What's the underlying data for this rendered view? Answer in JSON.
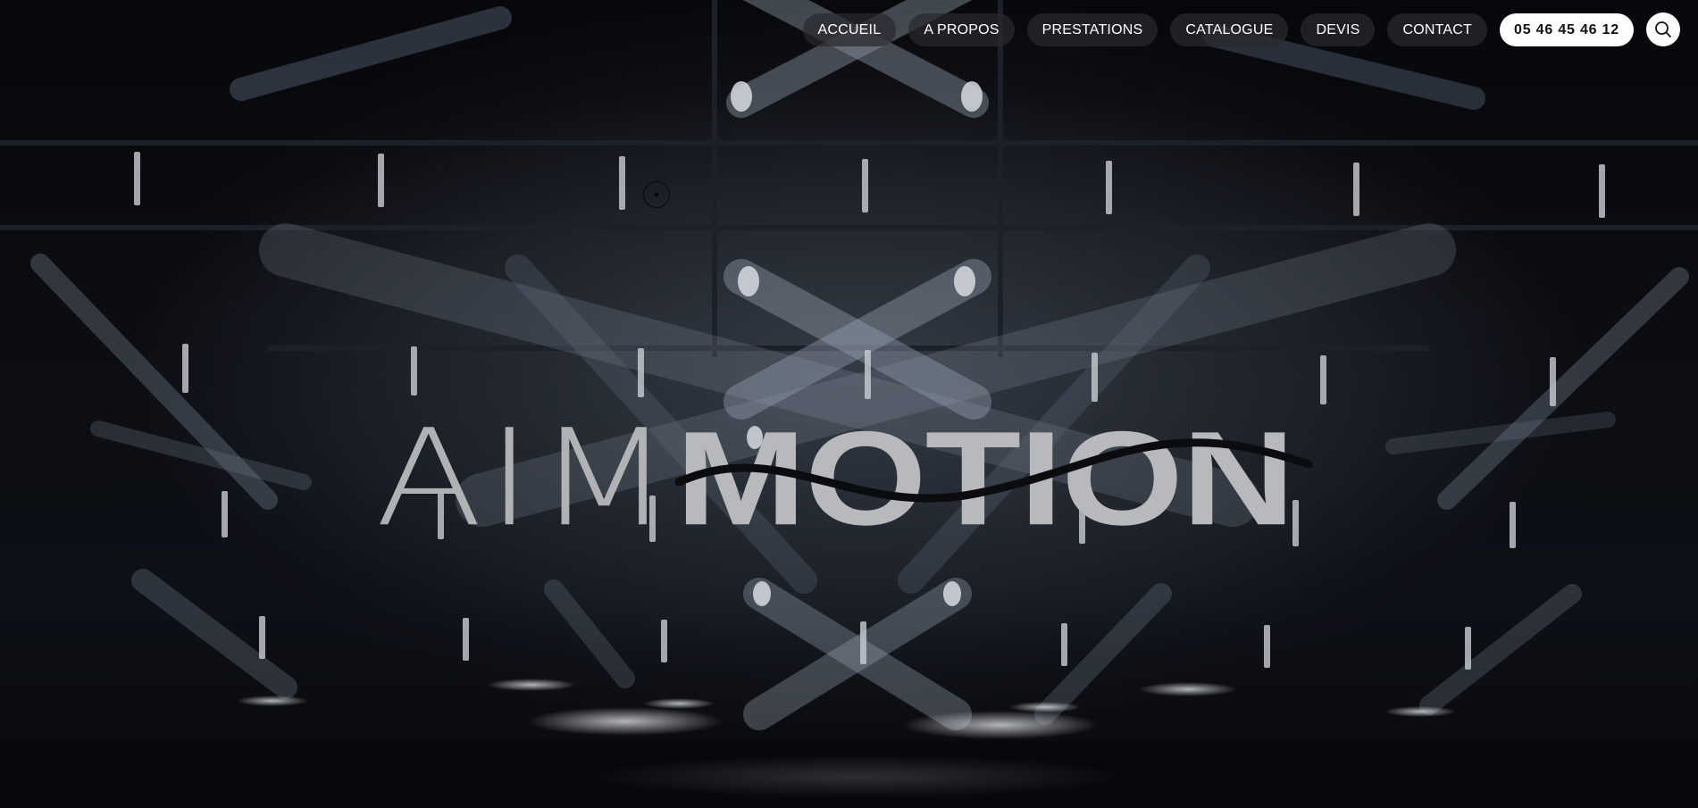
{
  "nav": {
    "items": [
      {
        "label": "ACCUEIL"
      },
      {
        "label": "A PROPOS"
      },
      {
        "label": "PRESTATIONS"
      },
      {
        "label": "CATALOGUE"
      },
      {
        "label": "DEVIS"
      },
      {
        "label": "CONTACT"
      }
    ],
    "phone": "05 46 45 46 12",
    "search_icon": "search-icon"
  },
  "logo": {
    "light_text": "AIM",
    "bold_text": "MOTION",
    "color": "#b8b9bc"
  },
  "colors": {
    "background": "#07080b",
    "nav_pill": "#2a2c30",
    "phone_pill": "#ffffff"
  }
}
